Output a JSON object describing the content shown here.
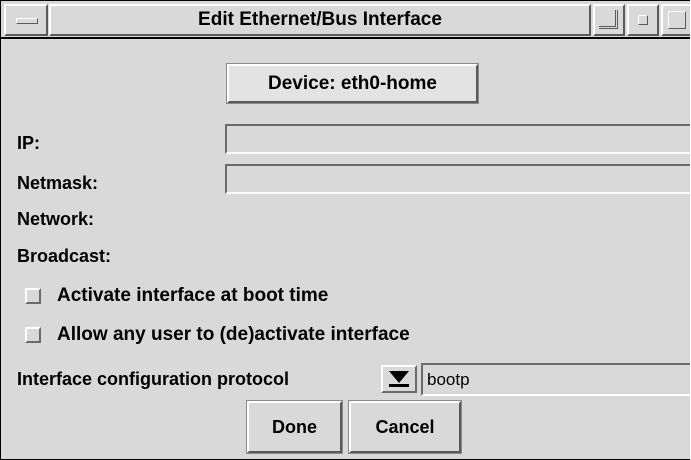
{
  "window": {
    "title": "Edit Ethernet/Bus Interface"
  },
  "device": {
    "label": "Device: eth0-home"
  },
  "fields": {
    "ip_label": "IP:",
    "ip_value": "",
    "netmask_label": "Netmask:",
    "netmask_value": "",
    "network_label": "Network:",
    "broadcast_label": "Broadcast:"
  },
  "options": {
    "activate_at_boot_label": "Activate interface at boot time",
    "activate_at_boot_checked": false,
    "allow_user_label": "Allow any user to (de)activate interface",
    "allow_user_checked": false
  },
  "protocol": {
    "label": "Interface configuration protocol",
    "value": "bootp"
  },
  "buttons": {
    "done": "Done",
    "cancel": "Cancel"
  },
  "icons": {
    "window_menu": "window-menu-icon",
    "shade": "shade-icon",
    "minimize": "minimize-icon",
    "maximize": "maximize-icon",
    "dropdown": "dropdown-arrow-icon"
  }
}
